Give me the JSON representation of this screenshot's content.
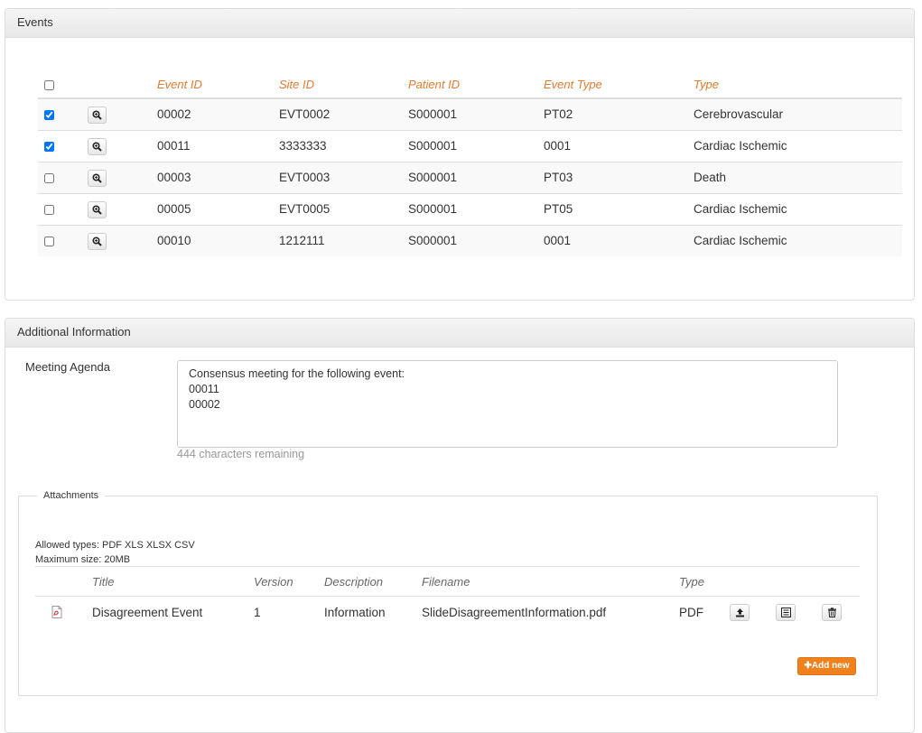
{
  "events": {
    "title": "Events",
    "columns": [
      "Event ID",
      "Site ID",
      "Patient ID",
      "Event Type",
      "Type"
    ],
    "rows": [
      {
        "checked": true,
        "event_id": "00002",
        "site_id": "EVT0002",
        "patient_id": "S000001",
        "event_type": "PT02",
        "type": "Cerebrovascular"
      },
      {
        "checked": true,
        "event_id": "00011",
        "site_id": "3333333",
        "patient_id": "S000001",
        "event_type": "0001",
        "type": "Cardiac Ischemic"
      },
      {
        "checked": false,
        "event_id": "00003",
        "site_id": "EVT0003",
        "patient_id": "S000001",
        "event_type": "PT03",
        "type": "Death"
      },
      {
        "checked": false,
        "event_id": "00005",
        "site_id": "EVT0005",
        "patient_id": "S000001",
        "event_type": "PT05",
        "type": "Cardiac Ischemic"
      },
      {
        "checked": false,
        "event_id": "00010",
        "site_id": "1212111",
        "patient_id": "S000001",
        "event_type": "0001",
        "type": "Cardiac Ischemic"
      }
    ]
  },
  "additional": {
    "title": "Additional Information",
    "agenda_label": "Meeting Agenda",
    "agenda_value": "Consensus meeting for the following event:\n00011\n00002",
    "chars_remaining": "444 characters remaining",
    "attachments": {
      "legend": "Attachments",
      "allowed_types": "Allowed types: PDF XLS XLSX CSV",
      "max_size": "Maximum size: 20MB",
      "columns": [
        "Title",
        "Version",
        "Description",
        "Filename",
        "Type"
      ],
      "rows": [
        {
          "title": "Disagreement Event",
          "version": "1",
          "description": "Information",
          "filename": "SlideDisagreementInformation.pdf",
          "type": "PDF"
        }
      ],
      "add_new_label": "Add new"
    }
  },
  "icons": {
    "view": "magnifier-icon",
    "pdf": "pdf-file-icon",
    "upload": "upload-icon",
    "details": "list-icon",
    "delete": "trash-icon"
  },
  "colors": {
    "accent": "#e8792b",
    "add_button": "#f0821e"
  }
}
